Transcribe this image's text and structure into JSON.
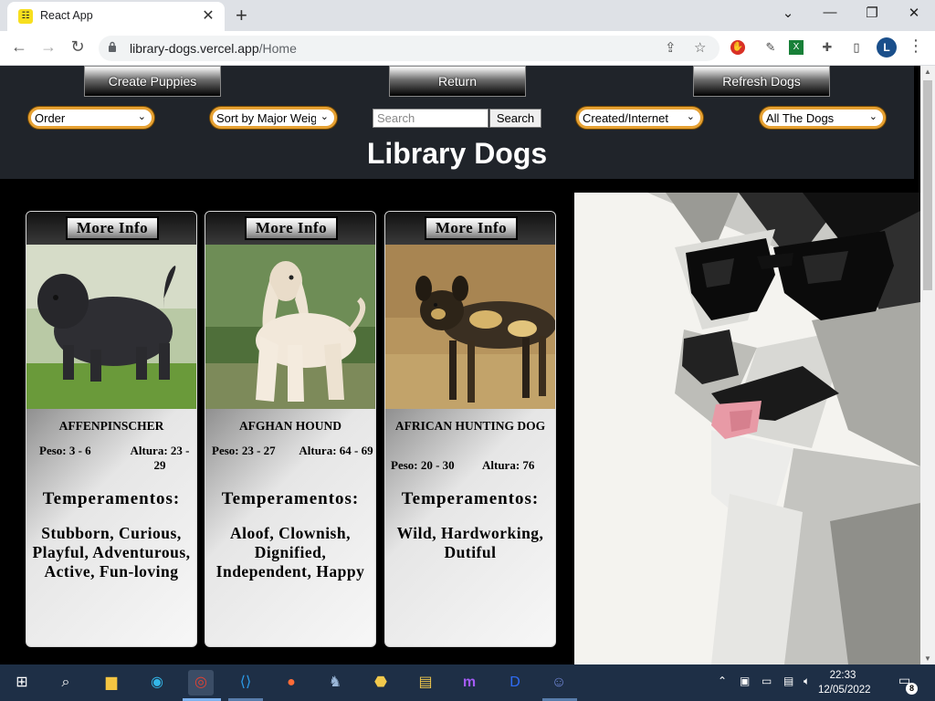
{
  "browser": {
    "tab_title": "React App",
    "url_host": "library-dogs.vercel.app",
    "url_path": "/Home",
    "profile_initial": "L"
  },
  "header": {
    "create_label": "Create Puppies",
    "return_label": "Return",
    "refresh_label": "Refresh Dogs",
    "order_select": "Order",
    "weight_select": "Sort by Major Weight",
    "search_placeholder": "Search",
    "search_button": "Search",
    "origin_select": "Created/Internet",
    "temper_select": "All The Dogs",
    "title": "Library Dogs"
  },
  "cards": [
    {
      "more_label": "More Info",
      "name": "AFFENPINSCHER",
      "peso": "Peso: 3 - 6",
      "altura": "Altura: 23 - 29",
      "temp_heading": "Temperamentos:",
      "temperaments": "Stubborn, Curious, Playful, Adventurous, Active, Fun-loving",
      "photo_icon": "black-shaggy-dog-photo"
    },
    {
      "more_label": "More Info",
      "name": "AFGHAN HOUND",
      "peso": "Peso: 23 - 27",
      "altura": "Altura: 64 - 69",
      "temp_heading": "Temperamentos:",
      "temperaments": "Aloof, Clownish, Dignified, Independent, Happy",
      "photo_icon": "afghan-hound-photo"
    },
    {
      "more_label": "More Info",
      "name": "AFRICAN HUNTING DOG",
      "peso": "Peso: 20 - 30",
      "altura": "Altura: 76",
      "temp_heading": "Temperamentos:",
      "temperaments": "Wild, Hardworking, Dutiful",
      "photo_icon": "african-wild-dog-photo"
    }
  ],
  "taskbar": {
    "time": "22:33",
    "date": "12/05/2022",
    "notifications": "8"
  },
  "colors": {
    "header_bg": "#20242a",
    "select_border": "#e6a133",
    "page_bg": "#000000"
  }
}
